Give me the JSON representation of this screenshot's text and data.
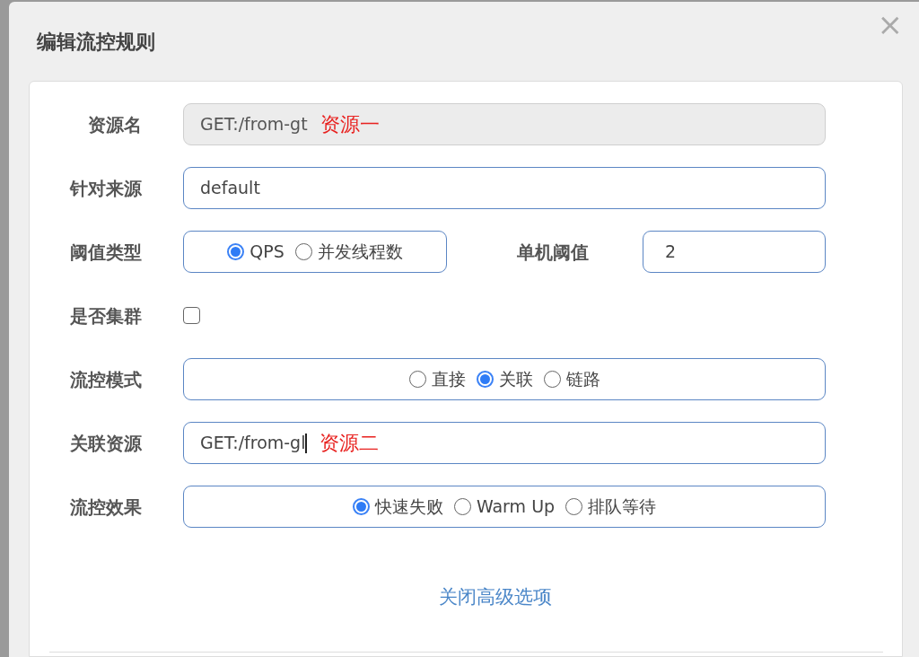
{
  "dialog": {
    "title": "编辑流控规则",
    "close": "×"
  },
  "rows": [
    {
      "label": "资源名",
      "kind": "input",
      "value": "GET:/from-gt",
      "annotation": "资源一",
      "disabled": true
    },
    {
      "label": "针对来源",
      "kind": "input",
      "value": "default",
      "disabled": false
    },
    {
      "label": "阈值类型",
      "kind": "radio",
      "options": [
        {
          "label": "QPS",
          "selected": true
        },
        {
          "label": "并发线程数",
          "selected": false
        }
      ],
      "extra": {
        "label": "单机阈值",
        "value": "2"
      }
    },
    {
      "label": "是否集群",
      "kind": "checkbox",
      "checked": false
    },
    {
      "label": "流控模式",
      "kind": "radio",
      "options": [
        {
          "label": "直接",
          "selected": false
        },
        {
          "label": "关联",
          "selected": true
        },
        {
          "label": "链路",
          "selected": false
        }
      ]
    },
    {
      "label": "关联资源",
      "kind": "input",
      "value": "GET:/from-gl",
      "annotation": "资源二",
      "disabled": false,
      "focused": true
    },
    {
      "label": "流控效果",
      "kind": "radio",
      "options": [
        {
          "label": "快速失败",
          "selected": true
        },
        {
          "label": "Warm Up",
          "selected": false
        },
        {
          "label": "排队等待",
          "selected": false
        }
      ]
    }
  ],
  "advanced_link": "关闭高级选项"
}
